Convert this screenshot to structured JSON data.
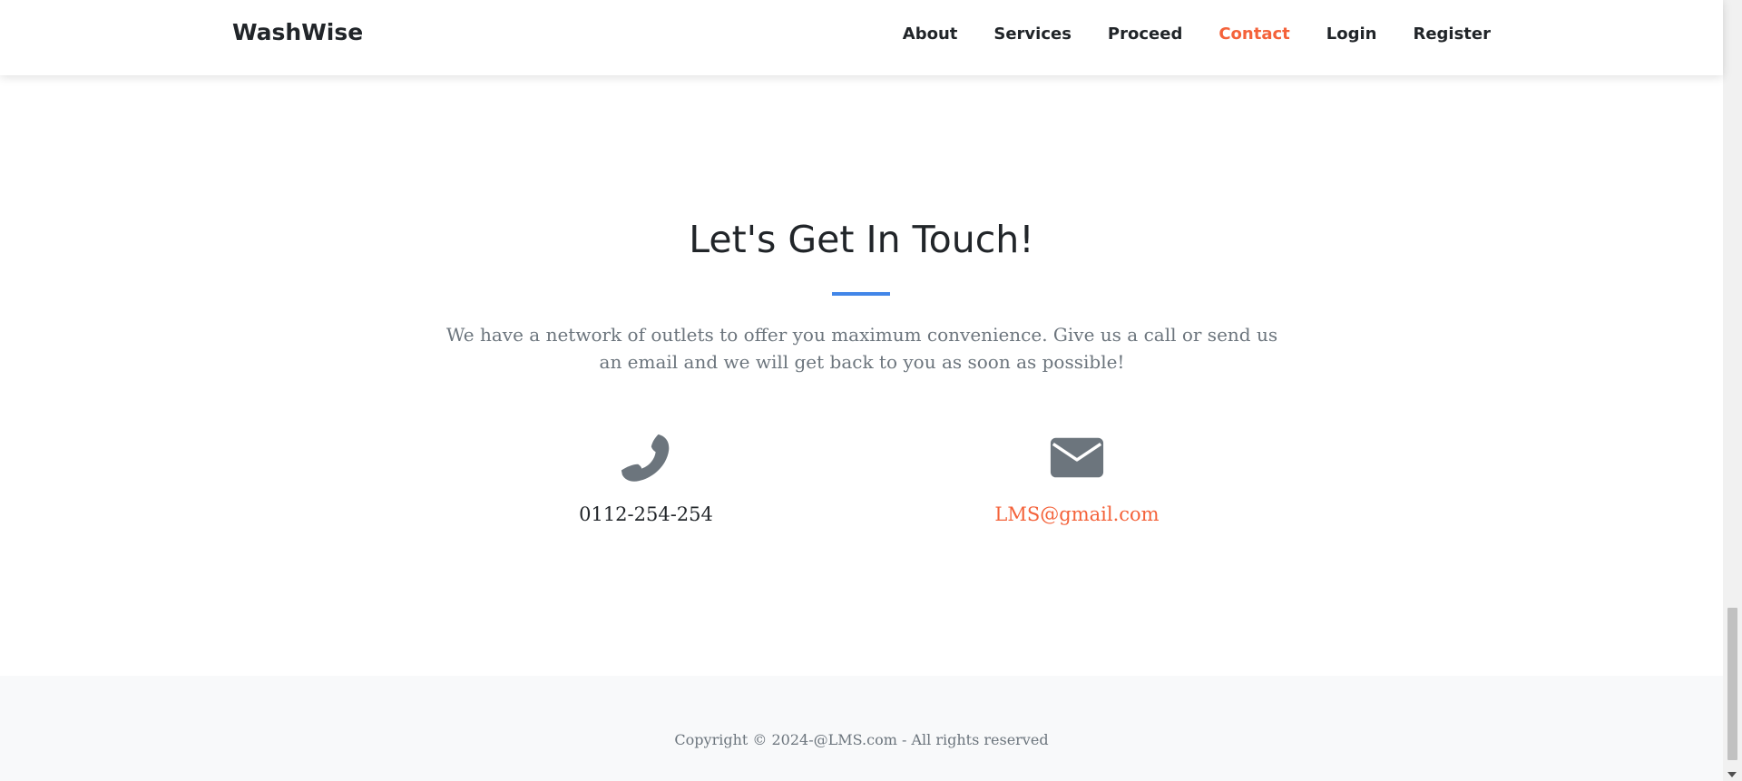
{
  "navbar": {
    "brand": "WashWise",
    "links": [
      {
        "label": "About"
      },
      {
        "label": "Services"
      },
      {
        "label": "Proceed"
      },
      {
        "label": "Contact"
      },
      {
        "label": "Login"
      },
      {
        "label": "Register"
      }
    ],
    "active_link": "Contact"
  },
  "contact": {
    "heading": "Let's Get In Touch!",
    "lead": "We have a network of outlets to offer you maximum convenience. Give us a call or send us an email and we will get back to you as soon as possible!",
    "phone": {
      "icon": "phone-icon",
      "text": "0112-254-254"
    },
    "email": {
      "icon": "envelope-icon",
      "text": "LMS@gmail.com"
    }
  },
  "footer": {
    "copyright": "Copyright © 2024-@LMS.com - All rights reserved"
  },
  "colors": {
    "accent": "#f4623a",
    "divider": "#4286e8",
    "icon": "#6c757d",
    "muted_text": "#6c757d",
    "footer_bg": "#f8f9fa"
  }
}
